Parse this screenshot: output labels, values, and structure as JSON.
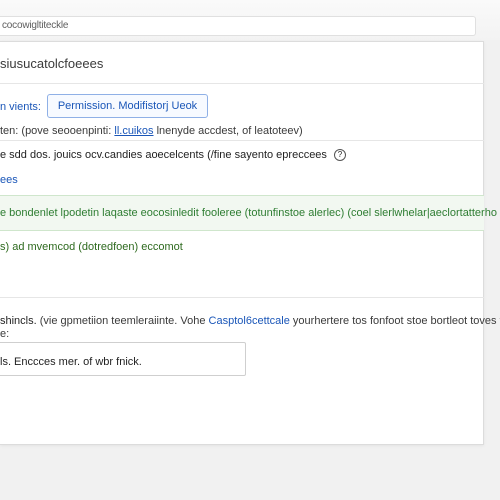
{
  "browser": {
    "url": "cocowigltiteckle"
  },
  "section": {
    "title": "siusucatolcfoeees",
    "row1": {
      "label": "n vients:",
      "button": "Permission. Modifistorj Ueok"
    },
    "row2": {
      "prefix": "ten: (pove seooenpinti:",
      "link": "ll.cuikos",
      "suffix": "lnenyde accdest, of leatoteev)"
    },
    "row3": {
      "text": "e sdd dos. jouics ocv.candies aoecelcents (/fine sayento epreccees",
      "icon": "?"
    },
    "row4": {
      "link": "ees"
    },
    "green": {
      "line1": "e bondenlet lpodetin laqaste eocosinledit fooleree (totunfinstoe alerlec) (coel slerlwhelar|aeclortatterho",
      "line2": "s) ad mvemcod (dotredfoen) eccomot"
    },
    "row5": {
      "label": "shincls.",
      "prefix": "(vie gpmetiion teemleraiinte. Vohe",
      "link": "Casptol6cettcale",
      "suffix": "yourhertere tos fonfoot stoe bortleot toves t"
    },
    "row5b": {
      "text": "e:"
    },
    "textbox": {
      "value": "ls. Enccces mer. of wbr fnick."
    }
  }
}
